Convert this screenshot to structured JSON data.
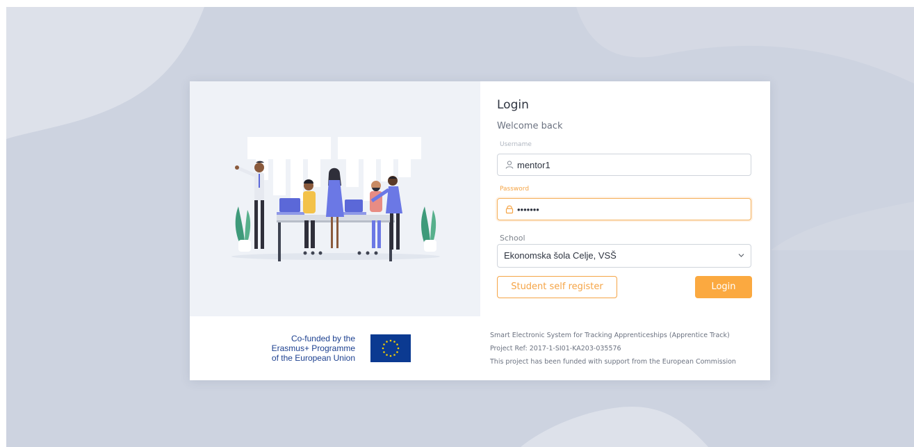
{
  "login": {
    "title": "Login",
    "subtitle": "Welcome back",
    "username_label": "Username",
    "username_value": "mentor1",
    "password_label": "Password",
    "password_value": "•••••••",
    "school_label": "School",
    "school_value": "Ekonomska šola Celje, VSŠ",
    "self_register_label": "Student self register",
    "login_button_label": "Login"
  },
  "footer": {
    "cofund_lines": [
      "Co-funded by the",
      "Erasmus+ Programme",
      "of the European Union"
    ],
    "project_name": "Smart Electronic System for Tracking Apprenticeships (Apprentice Track)",
    "project_ref": "Project Ref: 2017-1-SI01-KA203-035576",
    "funding_note": "This project has been funded with support from the European Commission"
  },
  "icons": {
    "username": "user-icon",
    "password": "lock-icon",
    "select": "chevron-down-icon",
    "flag": "eu-flag-icon"
  },
  "colors": {
    "accent": "#fba940",
    "background": "#cdd3e0",
    "eu_blue": "#0b3a91",
    "eu_star": "#f5d000"
  }
}
